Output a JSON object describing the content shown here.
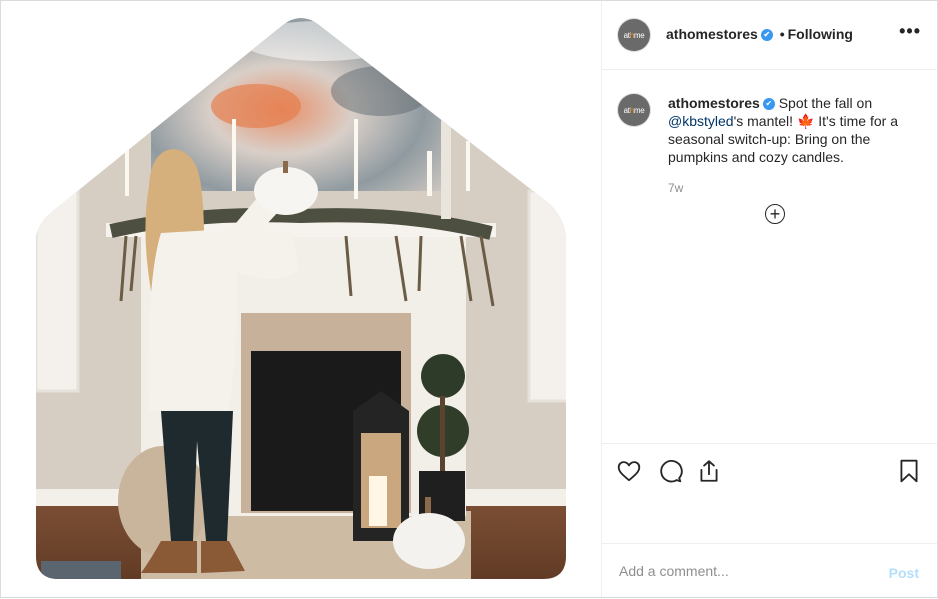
{
  "post": {
    "username": "athomestores",
    "avatar_text_a": "at",
    "avatar_text_b": "h",
    "avatar_text_c": "me",
    "verified_icon": "✔",
    "separator": "•",
    "follow_state": "Following",
    "more_icon": "•••"
  },
  "caption": {
    "username": "athomestores",
    "text_1": " Spot the fall on ",
    "mention": "@kbstyled",
    "text_2": "'s mantel! ",
    "emoji": "🍁",
    "text_3": " It's time for a seasonal switch-up: Bring on the pumpkins and cozy candles.",
    "age": "7w",
    "load_more_icon": "+"
  },
  "actions": {
    "like_icon": "heart-icon",
    "comment_icon": "comment-icon",
    "share_icon": "share-icon",
    "save_icon": "bookmark-icon"
  },
  "comment_box": {
    "placeholder": "Add a comment...",
    "post_label": "Post"
  },
  "colors": {
    "accent": "#3897f0",
    "post_disabled": "#b2dffc",
    "mention": "#003569"
  }
}
